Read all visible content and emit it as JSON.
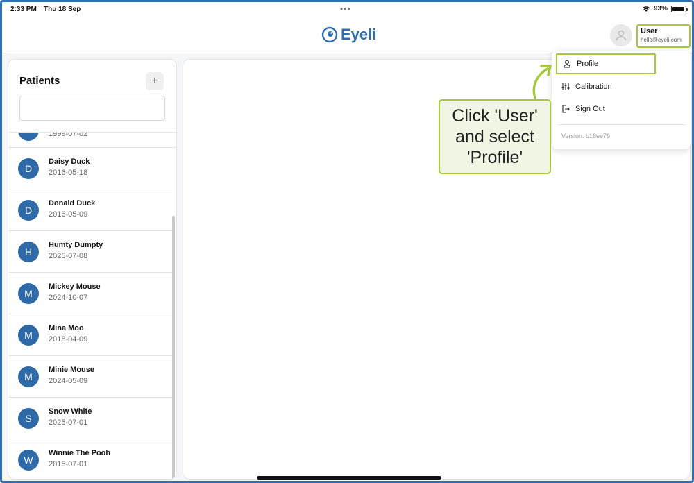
{
  "status_bar": {
    "time": "2:33 PM",
    "date": "Thu 18 Sep",
    "battery": "93%",
    "battery_level": 0.93
  },
  "header": {
    "app_name": "Eyeli",
    "user": {
      "name": "User",
      "email": "hello@eyeli.com"
    }
  },
  "patients": {
    "title": "Patients",
    "add_label": "+",
    "search_placeholder": "",
    "partial_row_date": "1999-07-02",
    "rows": [
      {
        "initial": "D",
        "name": "Daisy Duck",
        "dob": "2016-05-18"
      },
      {
        "initial": "D",
        "name": "Donald Duck",
        "dob": "2016-05-09"
      },
      {
        "initial": "H",
        "name": "Humty Dumpty",
        "dob": "2025-07-08"
      },
      {
        "initial": "M",
        "name": "Mickey Mouse",
        "dob": "2024-10-07"
      },
      {
        "initial": "M",
        "name": "Mina Moo",
        "dob": "2018-04-09"
      },
      {
        "initial": "M",
        "name": "Minie Mouse",
        "dob": "2024-05-09"
      },
      {
        "initial": "S",
        "name": "Snow White",
        "dob": "2025-07-01"
      },
      {
        "initial": "W",
        "name": "Winnie The Pooh",
        "dob": "2015-07-01"
      }
    ]
  },
  "menu": {
    "items": [
      {
        "label": "Profile",
        "icon": "person-icon"
      },
      {
        "label": "Calibration",
        "icon": "sliders-icon"
      },
      {
        "label": "Sign Out",
        "icon": "sign-out-icon"
      }
    ],
    "version": "Version: b18ee79"
  },
  "callout": {
    "text": "Click 'User'\nand select\n'Profile'"
  },
  "colors": {
    "brand": "#2f6fb0",
    "avatar": "#2e6aa8",
    "highlight": "#a6c93a",
    "callout_bg": "#f1f6e4"
  }
}
